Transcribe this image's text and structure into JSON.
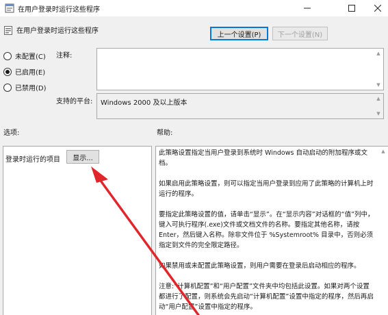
{
  "window": {
    "title": "在用户登录时运行这些程序",
    "minimize_icon": "minimize-icon",
    "maximize_icon": "maximize-icon",
    "close_icon": "close-icon"
  },
  "policy": {
    "name": "在用户登录时运行这些程序"
  },
  "nav": {
    "prev_label": "上一个设置(P)",
    "next_label": "下一个设置(N)"
  },
  "state": {
    "options": [
      {
        "label": "未配置(C)",
        "checked": false
      },
      {
        "label": "已启用(E)",
        "checked": true
      },
      {
        "label": "已禁用(D)",
        "checked": false
      }
    ]
  },
  "comment": {
    "label": "注释:",
    "value": ""
  },
  "platform": {
    "label": "支持的平台:",
    "value": "Windows 2000 及以上版本"
  },
  "sections": {
    "options_label": "选项:",
    "help_label": "帮助:"
  },
  "options_panel": {
    "item_label": "登录时运行的项目",
    "show_button": "显示..."
  },
  "help": {
    "paragraphs": [
      "此策略设置指定当用户登录到系统时 Windows 自动启动的附加程序或文档。",
      "如果启用此策略设置，则可以指定当用户登录到应用了此策略的计算机上时运行的程序。",
      "要指定此策略设置的值，请单击“显示”。在“显示内容”对话框的“值”列中，键入可执行程序(.exe)文件或文档文件的名称。要指定其他名称，请按 Enter，然后键入名称。除非文件位于 %Systemroot% 目录中，否则必须指定到文件的完全限定路径。",
      "如果禁用或未配置此策略设置，则用户需要在登录后启动相应的程序。",
      "注意:“计算机配置”和“用户配置”文件夹中均包括此设置。如果对两个设置都进行了配置，则系统会先启动“计算机配置”设置中指定的程序，然后再启动“用户配置”设置中指定的程序。"
    ]
  },
  "colors": {
    "annotation_arrow": "#e0262a",
    "focus_border": "#0078d7"
  }
}
